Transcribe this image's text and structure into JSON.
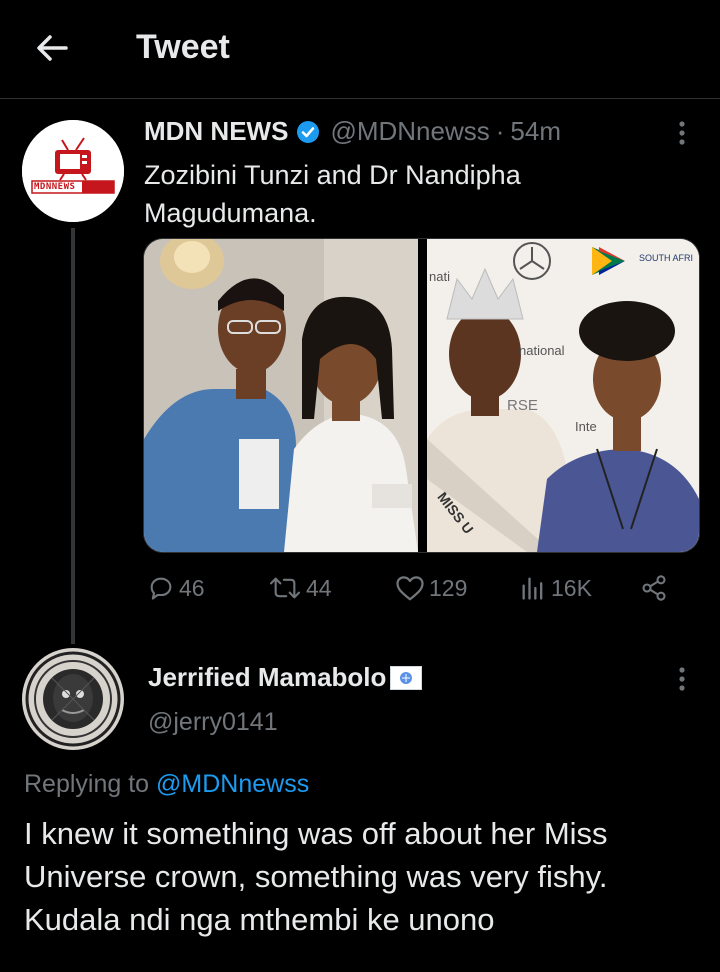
{
  "header": {
    "title": "Tweet",
    "back_icon": "arrow-left-icon"
  },
  "tweet": {
    "author_name": "MDN NEWS",
    "verified": true,
    "handle": "@MDNnewss",
    "separator": "·",
    "time": "54m",
    "text": "Zozibini Tunzi and Dr Nandipha Magudumana.",
    "avatar_logo_text": "MDNNEWS",
    "media": [
      {
        "kind": "photo",
        "description_icon": "photo-two-women"
      },
      {
        "kind": "photo",
        "overlay_texts": [
          "nati",
          "national",
          "Inte",
          "RSE",
          "SOUTH AFRI",
          "MISS U"
        ]
      }
    ],
    "stats": {
      "replies": "46",
      "retweets": "44",
      "likes": "129",
      "views": "16K"
    }
  },
  "reply": {
    "author_name": "Jerrified Mamabolo",
    "handle": "@jerry0141",
    "replying_prefix": "Replying to ",
    "replying_to": "@MDNnewss",
    "text": "I knew it something was off about her Miss Universe crown, something was very fishy. Kudala ndi nga mthembi ke unono"
  },
  "colors": {
    "background": "#000000",
    "text": "#e7e9ea",
    "muted": "#71767b",
    "accent": "#1d9bf0",
    "divider": "#2f3336"
  }
}
